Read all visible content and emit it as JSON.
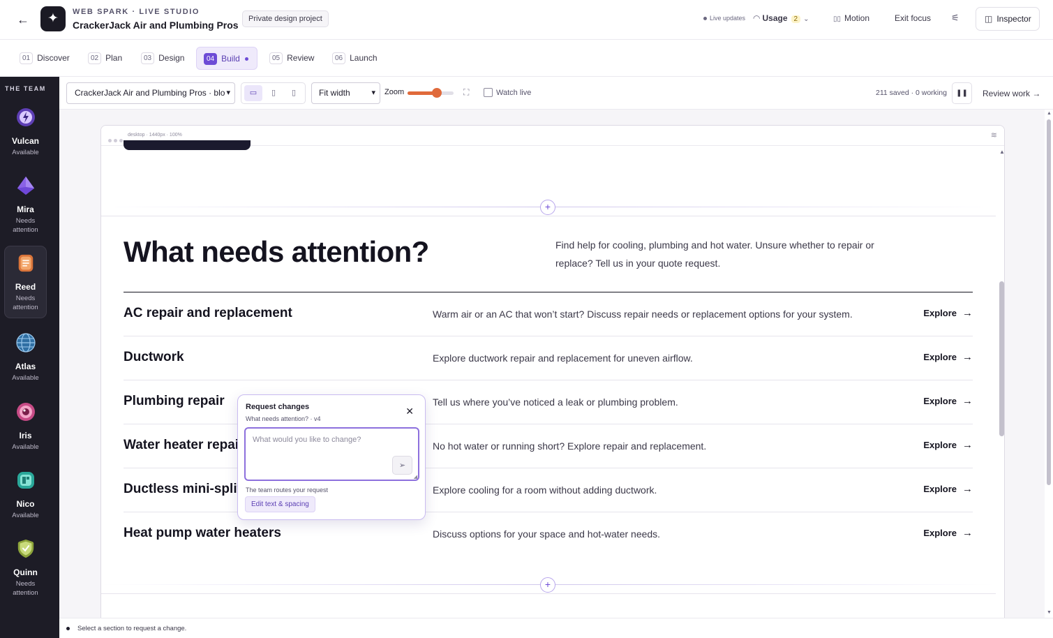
{
  "header": {
    "studio": "WEB SPARK · LIVE STUDIO",
    "project": "CrackerJack Air and Plumbing Pros",
    "tag": "Private design project",
    "live_updates": "Live updates",
    "usage_label": "Usage",
    "usage_count": "2",
    "motion": "Motion",
    "exit_focus": "Exit focus",
    "inspector": "Inspector"
  },
  "steps": [
    {
      "num": "01",
      "label": "Discover"
    },
    {
      "num": "02",
      "label": "Plan"
    },
    {
      "num": "03",
      "label": "Design"
    },
    {
      "num": "04",
      "label": "Build",
      "active": true
    },
    {
      "num": "05",
      "label": "Review"
    },
    {
      "num": "06",
      "label": "Launch"
    }
  ],
  "sidebar": {
    "title": "THE TEAM",
    "agents": [
      {
        "name": "Vulcan",
        "status": "Available",
        "icon": "lightning-avatar-icon",
        "color": "#8b5cf6"
      },
      {
        "name": "Mira",
        "status": "Needs attention",
        "icon": "crystal-avatar-icon",
        "color": "#7c4ddb"
      },
      {
        "name": "Reed",
        "status": "Needs attention",
        "icon": "document-avatar-icon",
        "color": "#e58a4c"
      },
      {
        "name": "Atlas",
        "status": "Available",
        "icon": "globe-avatar-icon",
        "color": "#4a8ac2"
      },
      {
        "name": "Iris",
        "status": "Available",
        "icon": "eye-avatar-icon",
        "color": "#e36aa0"
      },
      {
        "name": "Nico",
        "status": "Available",
        "icon": "layout-avatar-icon",
        "color": "#3fc6b6"
      },
      {
        "name": "Quinn",
        "status": "Needs attention",
        "icon": "shield-check-avatar-icon",
        "color": "#a3b84a"
      }
    ]
  },
  "toolbar": {
    "page_select": "CrackerJack Air and Plumbing Pros · bloc",
    "fit_select": "Fit width",
    "zoom_label": "Zoom",
    "zoom_level": 0.63,
    "watch_live": "Watch live",
    "saved_status": "211 saved · 0 working",
    "review_work": "Review work"
  },
  "frame": {
    "meta": "desktop · 1440px · 100%"
  },
  "section": {
    "heading": "What needs attention?",
    "intro": "Find help for cooling, plumbing and hot water. Unsure whether to repair or replace? Tell us in your quote request.",
    "services": [
      {
        "title": "AC repair and replacement",
        "desc": "Warm air or an AC that won’t start? Discuss repair needs or replacement options for your system.",
        "cta": "Explore"
      },
      {
        "title": "Ductwork",
        "desc": "Explore ductwork repair and replacement for uneven airflow.",
        "cta": "Explore"
      },
      {
        "title": "Plumbing repair",
        "desc": "Tell us where you’ve noticed a leak or plumbing problem.",
        "cta": "Explore"
      },
      {
        "title": "Water heater repair",
        "desc": "No hot water or running short? Explore repair and replacement.",
        "cta": "Explore"
      },
      {
        "title": "Ductless mini-splits",
        "desc": "Explore cooling for a room without adding ductwork.",
        "cta": "Explore"
      },
      {
        "title": "Heat pump water heaters",
        "desc": "Discuss options for your space and hot-water needs.",
        "cta": "Explore"
      }
    ]
  },
  "request_popover": {
    "title": "Request changes",
    "subtitle": "What needs attention? · v4",
    "placeholder": "What would you like to change?",
    "route_note": "The team routes your request",
    "edit_button": "Edit text & spacing"
  },
  "status_bar": {
    "text": "Select a section to request a change."
  },
  "colors": {
    "accent": "#6d4bd6",
    "sidebar_bg": "#1d1c26",
    "zoom_slider": "#e06a3b"
  }
}
